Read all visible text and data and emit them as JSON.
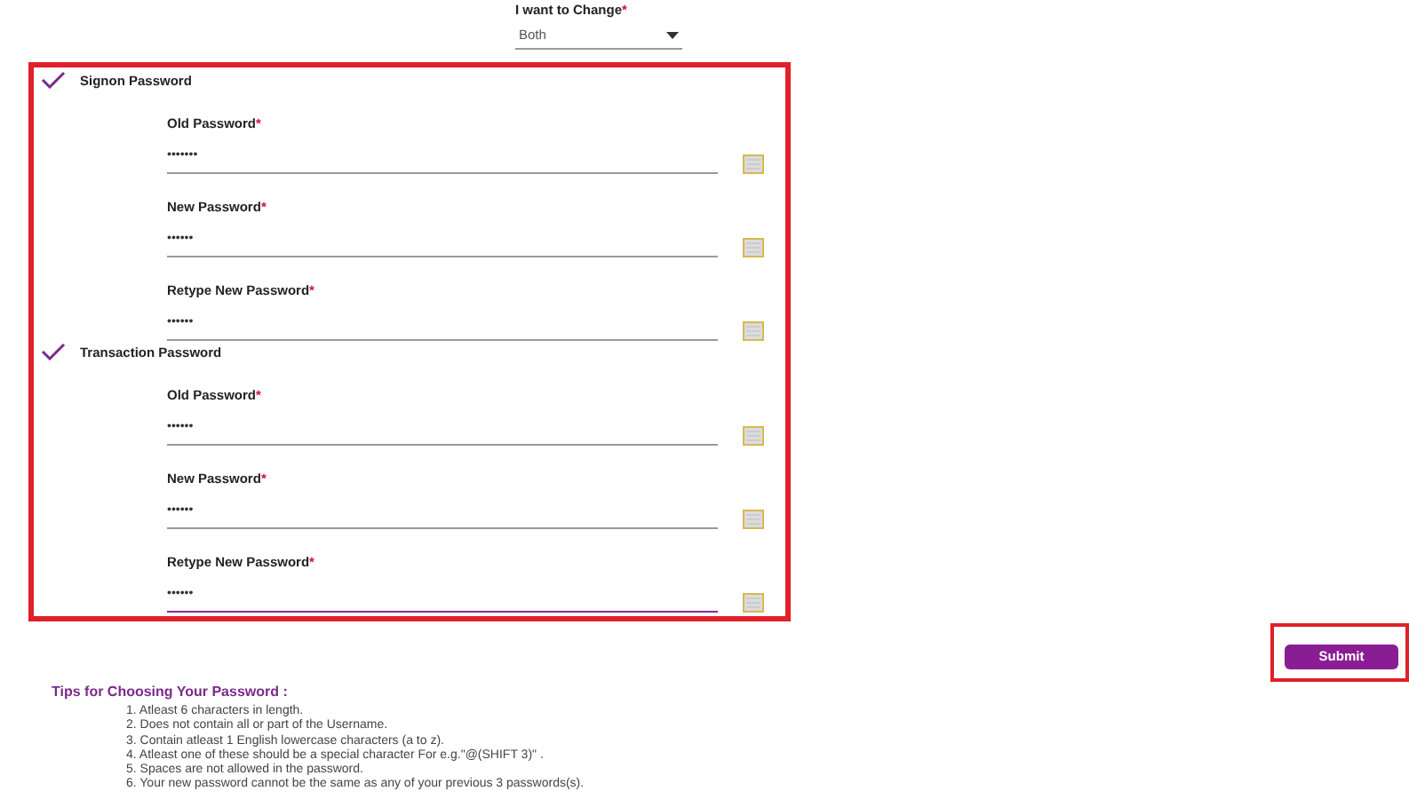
{
  "change_select": {
    "label": "I want to Change",
    "required_mark": "*",
    "value": "Both"
  },
  "sections": [
    {
      "title": "Signon Password",
      "checked": true,
      "fields": [
        {
          "label": "Old Password",
          "required_mark": "*",
          "value": "•••••••",
          "focused": false
        },
        {
          "label": "New Password",
          "required_mark": "*",
          "value": "••••••",
          "focused": false
        },
        {
          "label": "Retype New Password",
          "required_mark": "*",
          "value": "••••••",
          "focused": false
        }
      ]
    },
    {
      "title": "Transaction Password",
      "checked": true,
      "fields": [
        {
          "label": "Old Password",
          "required_mark": "*",
          "value": "••••••",
          "focused": false
        },
        {
          "label": "New Password",
          "required_mark": "*",
          "value": "••••••",
          "focused": false
        },
        {
          "label": "Retype New Password",
          "required_mark": "*",
          "value": "••••••",
          "focused": true
        }
      ]
    }
  ],
  "submit_button": "Submit",
  "tips": {
    "title": "Tips for Choosing Your Password :",
    "items": [
      "1. Atleast 6 characters in length.",
      "2. Does not contain all or part of the Username.",
      "3. Contain atleast 1 English lowercase characters (a to z).",
      "4. Atleast one of these should be a special character For e.g.\"@(SHIFT 3)\" .",
      "5. Spaces are not allowed in the password.",
      "6. Your new password cannot be the same as any of your previous 3 passwords(s)."
    ]
  }
}
